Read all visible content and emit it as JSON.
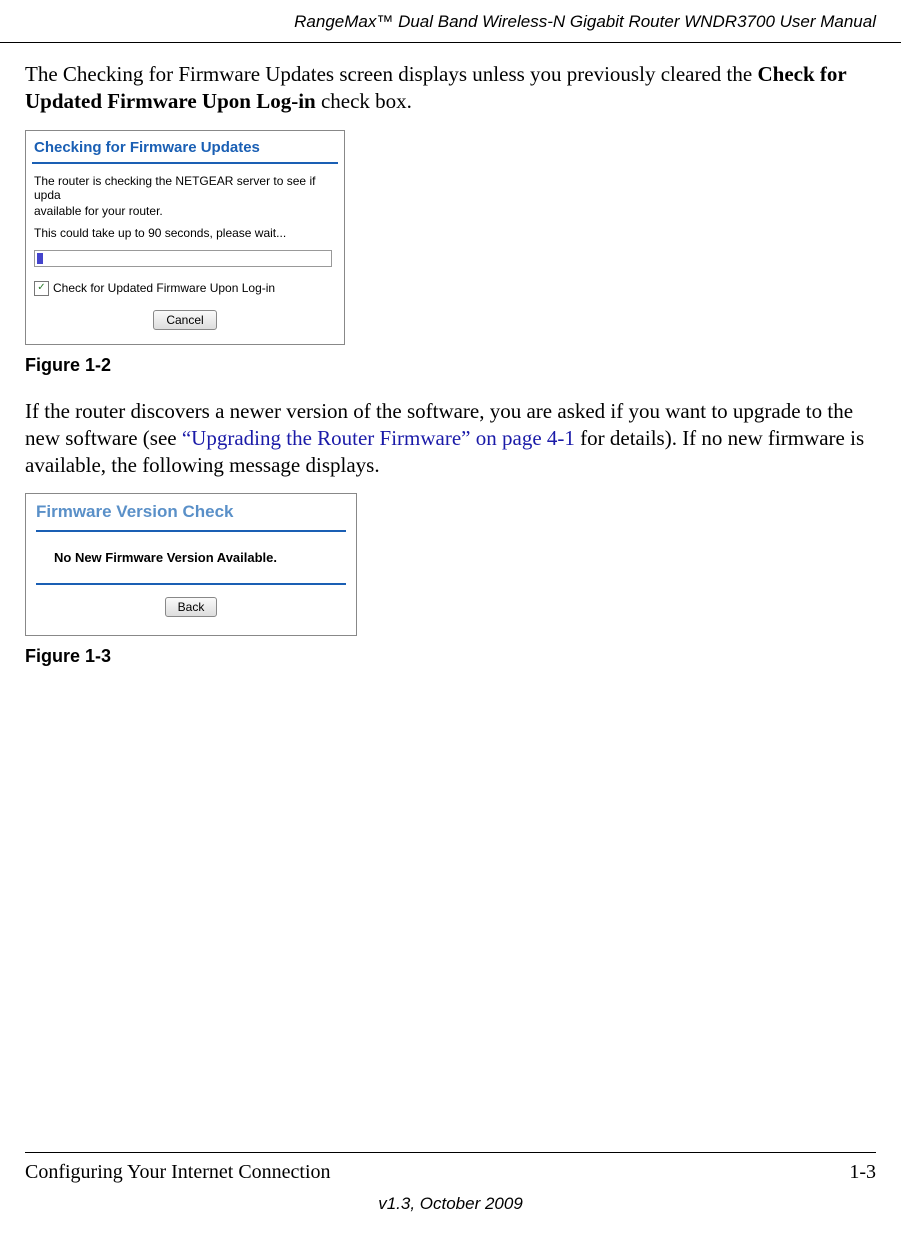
{
  "header": {
    "title": "RangeMax™ Dual Band Wireless-N Gigabit Router WNDR3700 User Manual"
  },
  "para1": {
    "pre": "The Checking for Firmware Updates screen displays unless you previously cleared the ",
    "bold": "Check for Updated Firmware Upon Log-in",
    "post": " check box."
  },
  "fig1": {
    "title": "Checking for Firmware Updates",
    "line1": "The router is checking the NETGEAR server to see if upda",
    "line2": "available for your router.",
    "line3": "This could take up to 90 seconds, please wait...",
    "checkbox_label": "Check for Updated Firmware Upon Log-in",
    "cancel": "Cancel",
    "caption": "Figure 1-2"
  },
  "para2": {
    "pre": "If the router discovers a newer version of the software, you are asked if you want to upgrade to the new software (see ",
    "link": "“Upgrading the Router Firmware” on page 4-1",
    "post": " for details). If no new firmware is available, the following message displays."
  },
  "fig2": {
    "title": "Firmware Version Check",
    "msg": "No New Firmware Version Available.",
    "back": "Back",
    "caption": "Figure 1-3"
  },
  "footer": {
    "section": "Configuring Your Internet Connection",
    "page": "1-3",
    "version": "v1.3, October 2009"
  }
}
